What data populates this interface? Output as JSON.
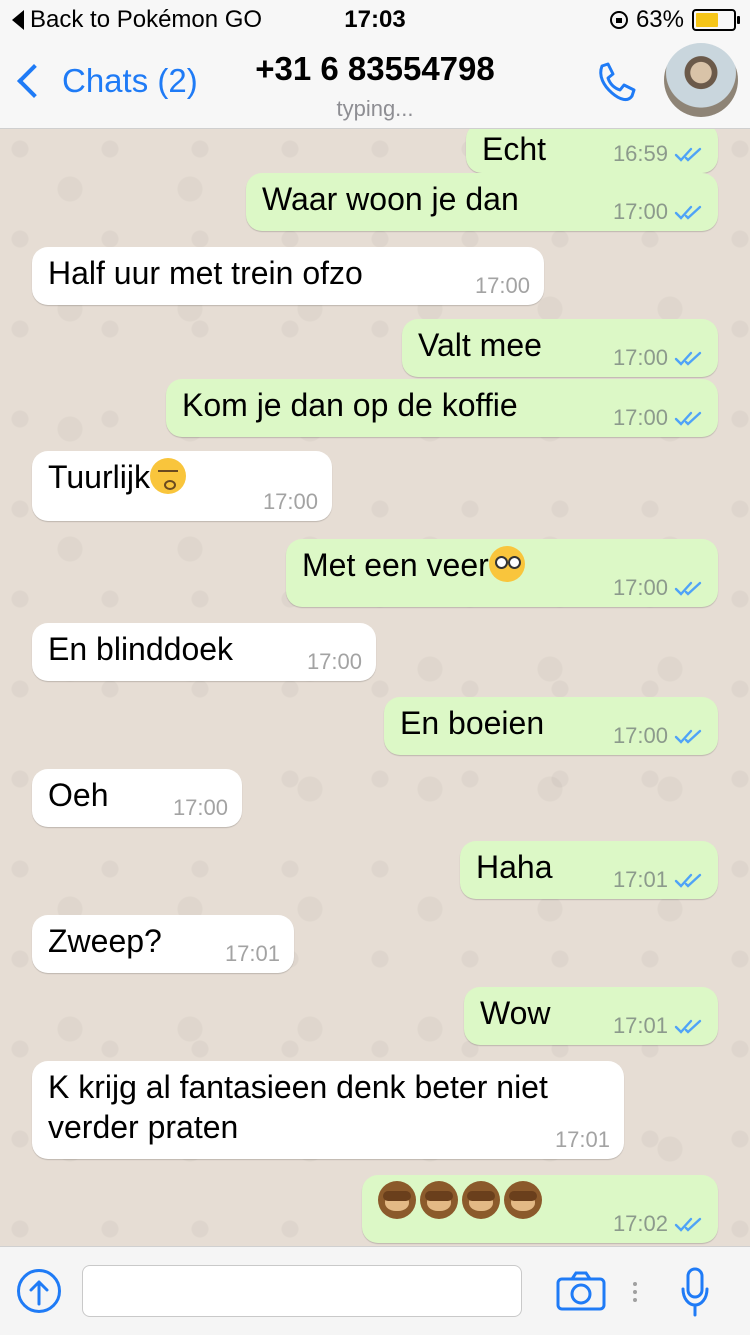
{
  "statusbar": {
    "back_app": "Back to Pokémon GO",
    "time": "17:03",
    "battery": "63%",
    "battery_level": 0.63
  },
  "header": {
    "back_label": "Chats (2)",
    "contact": "+31 6 83554798",
    "status": "typing..."
  },
  "messages": [
    {
      "dir": "out",
      "text": "Echt",
      "time": "16:59",
      "read": true
    },
    {
      "dir": "out",
      "text": "Waar woon je dan",
      "time": "17:00",
      "read": true
    },
    {
      "dir": "in",
      "text": "Half uur met trein ofzo",
      "time": "17:00"
    },
    {
      "dir": "out",
      "text": "Valt mee",
      "time": "17:00",
      "read": true
    },
    {
      "dir": "out",
      "text": "Kom je dan op de koffie",
      "time": "17:00",
      "read": true
    },
    {
      "dir": "in",
      "text": "Tuurlijk",
      "emoji": "kissing-face-closed-eyes",
      "time": "17:00"
    },
    {
      "dir": "out",
      "text": "Met een veer",
      "emoji": "flushed-face",
      "time": "17:00",
      "read": true
    },
    {
      "dir": "in",
      "text": "En blinddoek",
      "time": "17:00"
    },
    {
      "dir": "out",
      "text": "En boeien",
      "time": "17:00",
      "read": true
    },
    {
      "dir": "in",
      "text": "Oeh",
      "time": "17:00"
    },
    {
      "dir": "out",
      "text": "Haha",
      "time": "17:01",
      "read": true
    },
    {
      "dir": "in",
      "text": "Zweep?",
      "time": "17:01"
    },
    {
      "dir": "out",
      "text": "Wow",
      "time": "17:01",
      "read": true
    },
    {
      "dir": "in",
      "text": "K krijg al fantasieen denk beter niet",
      "text2": "verder praten",
      "time": "17:01"
    },
    {
      "dir": "out",
      "text": "",
      "emoji": "speak-no-evil-monkey x4",
      "time": "17:02",
      "read": true
    }
  ],
  "colors": {
    "accent": "#1f7bf6",
    "outgoing_bubble": "#dcf8c6",
    "incoming_bubble": "#ffffff",
    "read_ticks": "#4fa3f7",
    "chat_background": "#e6ddd4"
  },
  "icons": [
    "back-triangle-icon",
    "rotation-lock-icon",
    "battery-icon",
    "chevron-left-icon",
    "phone-icon",
    "avatar",
    "share-upload-icon",
    "camera-icon",
    "more-dots-icon",
    "microphone-icon",
    "double-check-icon"
  ]
}
